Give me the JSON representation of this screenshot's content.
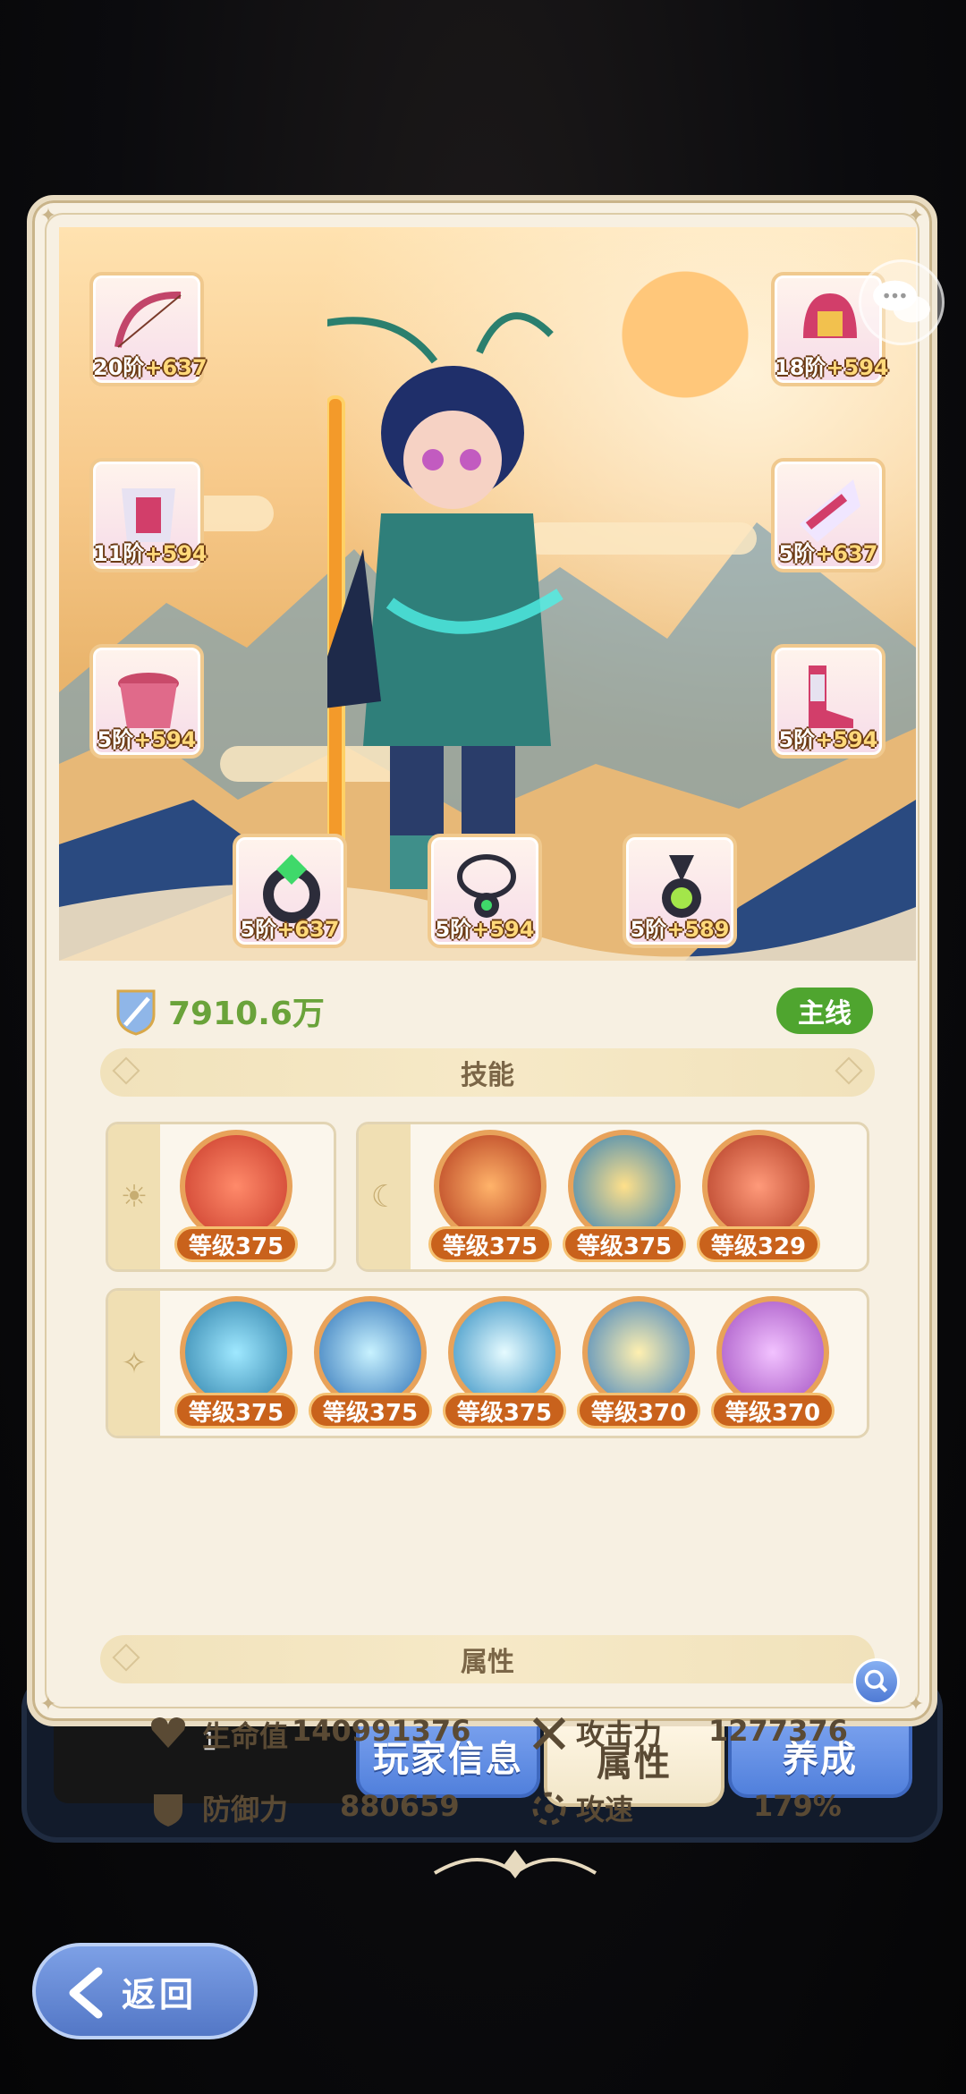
{
  "power": {
    "value": "7910.6万",
    "badge": "主线"
  },
  "equipment": [
    {
      "id": "bow",
      "tier": "20阶",
      "plus": "+637"
    },
    {
      "id": "helmet",
      "tier": "18阶",
      "plus": "+594"
    },
    {
      "id": "armor",
      "tier": "11阶",
      "plus": "+594"
    },
    {
      "id": "mask",
      "tier": "5阶",
      "plus": "+637"
    },
    {
      "id": "belt",
      "tier": "5阶",
      "plus": "+594"
    },
    {
      "id": "boots",
      "tier": "5阶",
      "plus": "+594"
    },
    {
      "id": "ring",
      "tier": "5阶",
      "plus": "+637"
    },
    {
      "id": "necklace",
      "tier": "5阶",
      "plus": "+594"
    },
    {
      "id": "amulet",
      "tier": "5阶",
      "plus": "+589"
    }
  ],
  "skills_title": "技能",
  "skills_row1_left": [
    {
      "level": "等级375",
      "color": "#c83a2a"
    }
  ],
  "skills_row1_right": [
    {
      "level": "等级375",
      "color": "#b2381c"
    },
    {
      "level": "等级375",
      "color": "#2f7fb8"
    },
    {
      "level": "等级329",
      "color": "#b03a22"
    }
  ],
  "skills_row2": [
    {
      "level": "等级375",
      "color": "#2d7fa8"
    },
    {
      "level": "等级375",
      "color": "#2b6fb5"
    },
    {
      "level": "等级375",
      "color": "#2c8bc0"
    },
    {
      "level": "等级370",
      "color": "#3b7fbf"
    },
    {
      "level": "等级370",
      "color": "#a14ec0"
    }
  ],
  "attributes_title": "属性",
  "stats": {
    "hp_label": "生命值",
    "hp_value": "140991376",
    "atk_label": "攻击力",
    "atk_value": "1277376",
    "def_label": "防御力",
    "def_value": "880659",
    "spd_label": "攻速",
    "spd_value": "179%"
  },
  "tabs": {
    "player_info": "玩家信息",
    "attributes": "属性",
    "develop": "养成"
  },
  "dock_number": "1",
  "back_label": "返回",
  "colors": {
    "accent_green": "#4fa52f",
    "tab_blue": "#5180dc",
    "level_orange": "#c9621c"
  }
}
